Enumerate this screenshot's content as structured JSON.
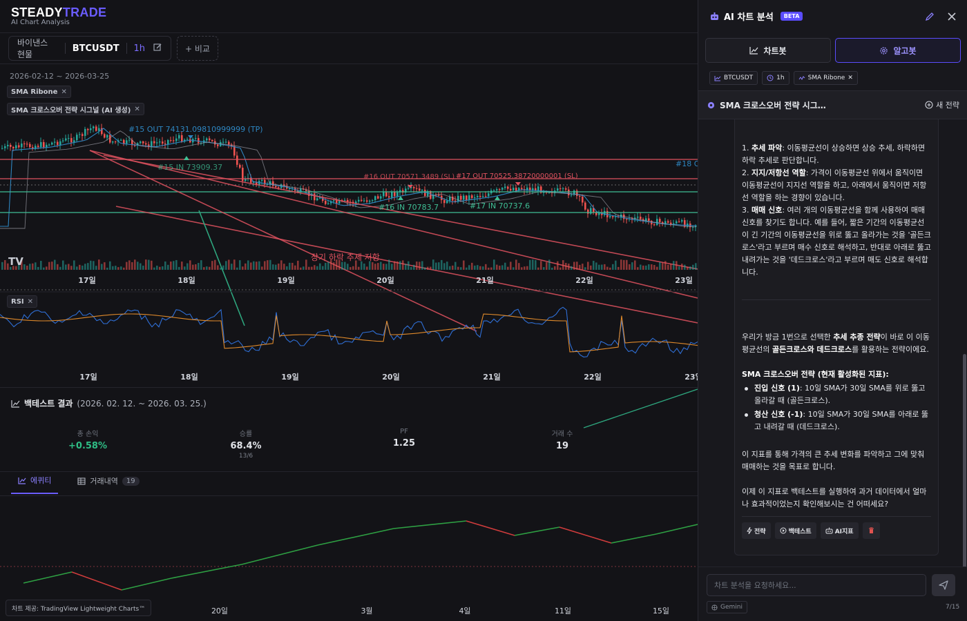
{
  "logo": {
    "part1": "STEADY",
    "part2": "TRADE",
    "sub": "AI Chart Analysis"
  },
  "symbol_bar": {
    "exchange": "바이낸스 현물",
    "symbol": "BTCUSDT",
    "timeframe": "1h",
    "compare_label": "+ 비교"
  },
  "date_range": "2026-02-12 ~ 2026-03-25",
  "indicator_chips": [
    "SMA Ribone",
    "SMA 크로스오버 전략 시그널 (AI 생성)"
  ],
  "rsi_chip": "RSI",
  "chart_markers": {
    "m15out": "#15 OUT 74131.09810999999 (TP)",
    "m15in": "#15 IN 73909.37",
    "m16out": "#16 OUT 70571.3489 (SL)",
    "m17out": "#17 OUT 70525.38720000001 (SL)",
    "m16in": "#16 IN 70783.7",
    "m17in": "#17 IN 70737.6",
    "m18": "#18 O",
    "annotation": "장기 하락 추세 저항"
  },
  "main_x_ticks": [
    "17일",
    "18일",
    "19일",
    "20일",
    "21일",
    "22일",
    "23일"
  ],
  "rsi_x_ticks": [
    "17일",
    "18일",
    "19일",
    "20일",
    "21일",
    "22일",
    "23일"
  ],
  "backtest": {
    "title": "백테스트 결과",
    "range": "(2026. 02. 12. ~ 2026. 03. 25.)",
    "stats": [
      {
        "label": "총 손익",
        "value": "+0.58%",
        "sub": ""
      },
      {
        "label": "승률",
        "value": "68.4%",
        "sub": "13/6"
      },
      {
        "label": "PF",
        "value": "1.25",
        "sub": ""
      },
      {
        "label": "거래 수",
        "value": "19",
        "sub": ""
      }
    ],
    "tabs": [
      {
        "label": "에퀴티",
        "count": ""
      },
      {
        "label": "거래내역",
        "count": "19"
      }
    ]
  },
  "equity_x_ticks": [
    "20일",
    "3월",
    "4일",
    "11일",
    "15일"
  ],
  "equity_curve": [
    0.0,
    0.15,
    -0.25,
    0.05,
    0.58
  ],
  "credit": "차트 제공: TradingView Lightweight Charts™",
  "panel": {
    "title": "AI 차트 분석",
    "badge": "BETA",
    "mode_tabs": [
      "차트봇",
      "알고봇"
    ],
    "tags": [
      "BTCUSDT",
      "1h",
      "SMA Ribone"
    ],
    "conversation_title": "SMA 크로스오버 전략 시그…",
    "new_strategy": "새 전략",
    "input_placeholder": "차트 분석을 요청하세요...",
    "model": "Gemini",
    "counter": "7/15",
    "actions": [
      "전략",
      "백테스트",
      "AI지표"
    ]
  },
  "message": {
    "p1_items": [
      {
        "num": "1.",
        "bold": "추세 파악",
        "text": ": 이동평균선이 상승하면 상승 추세, 하락하면 하락 추세로 판단합니다."
      },
      {
        "num": "2.",
        "bold": "지지/저항선 역할",
        "text": ": 가격이 이동평균선 위에서 움직이면 이동평균선이 지지선 역할을 하고, 아래에서 움직이면 저항선 역할을 하는 경향이 있습니다."
      },
      {
        "num": "3.",
        "bold": "매매 신호",
        "text": ": 여러 개의 이동평균선을 함께 사용하여 매매 신호를 찾기도 합니다. 예를 들어, 짧은 기간의 이동평균선이 긴 기간의 이동평균선을 위로 뚫고 올라가는 것을 '골든크로스'라고 부르며 매수 신호로 해석하고, 반대로 아래로 뚫고 내려가는 것을 '데드크로스'라고 부르며 매도 신호로 해석합니다."
      }
    ],
    "p2a": "우리가 방금 1번으로 선택한 ",
    "p2b": "추세 추종 전략",
    "p2c": "이 바로 이 이동평균선의 ",
    "p2d": "골든크로스와 데드크로스",
    "p2e": "를 활용하는 전략이에요.",
    "h3": "SMA 크로스오버 전략 (현재 활성화된 지표):",
    "bullets": [
      {
        "bold": "진입 신호 (1)",
        "text": ": 10일 SMA가 30일 SMA를 위로 뚫고 올라갈 때 (골든크로스)."
      },
      {
        "bold": "청산 신호 (-1)",
        "text": ": 10일 SMA가 30일 SMA를 아래로 뚫고 내려갈 때 (데드크로스)."
      }
    ],
    "p4": "이 지표를 통해 가격의 큰 추세 변화를 파악하고 그에 맞춰 매매하는 것을 목표로 합니다.",
    "p5": "이제 이 지표로 백테스트를 실행하여 과거 데이터에서 얼마나 효과적이었는지 확인해보시는 건 어떠세요?"
  },
  "colors": {
    "accent": "#6a5cff",
    "up": "#26a69a",
    "down": "#ef5350",
    "green_text": "#2ebd85"
  }
}
